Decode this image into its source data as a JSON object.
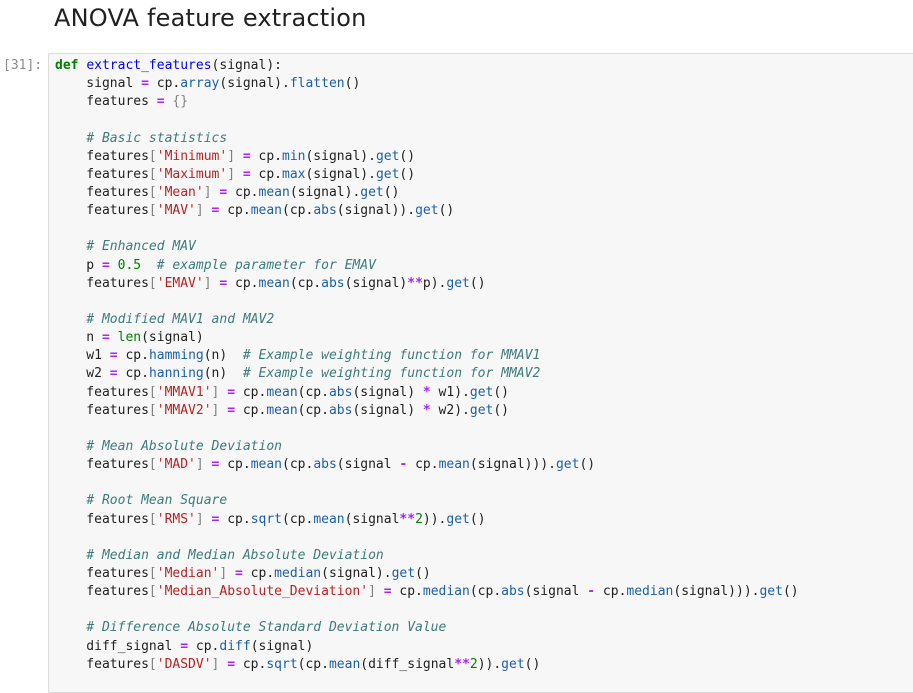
{
  "notebook": {
    "heading": "ANOVA feature extraction",
    "cell": {
      "prompt": "[31]:",
      "language": "python"
    }
  },
  "code_lines": [
    [
      [
        "kw",
        "def"
      ],
      [
        "t",
        " "
      ],
      [
        "fn",
        "extract_features"
      ],
      [
        "t",
        "(signal):"
      ]
    ],
    [
      [
        "t",
        "    signal "
      ],
      [
        "op",
        "="
      ],
      [
        "t",
        " cp."
      ],
      [
        "at",
        "array"
      ],
      [
        "t",
        "(signal)."
      ],
      [
        "at",
        "flatten"
      ],
      [
        "t",
        "()"
      ]
    ],
    [
      [
        "t",
        "    features "
      ],
      [
        "op",
        "="
      ],
      [
        "t",
        " "
      ],
      [
        "br",
        "{}"
      ]
    ],
    [
      [
        "t",
        ""
      ]
    ],
    [
      [
        "t",
        "    "
      ],
      [
        "cm",
        "# Basic statistics"
      ]
    ],
    [
      [
        "t",
        "    features"
      ],
      [
        "br",
        "["
      ],
      [
        "st",
        "'Minimum'"
      ],
      [
        "br",
        "]"
      ],
      [
        "t",
        " "
      ],
      [
        "op",
        "="
      ],
      [
        "t",
        " cp."
      ],
      [
        "at",
        "min"
      ],
      [
        "t",
        "(signal)."
      ],
      [
        "at",
        "get"
      ],
      [
        "t",
        "()"
      ]
    ],
    [
      [
        "t",
        "    features"
      ],
      [
        "br",
        "["
      ],
      [
        "st",
        "'Maximum'"
      ],
      [
        "br",
        "]"
      ],
      [
        "t",
        " "
      ],
      [
        "op",
        "="
      ],
      [
        "t",
        " cp."
      ],
      [
        "at",
        "max"
      ],
      [
        "t",
        "(signal)."
      ],
      [
        "at",
        "get"
      ],
      [
        "t",
        "()"
      ]
    ],
    [
      [
        "t",
        "    features"
      ],
      [
        "br",
        "["
      ],
      [
        "st",
        "'Mean'"
      ],
      [
        "br",
        "]"
      ],
      [
        "t",
        " "
      ],
      [
        "op",
        "="
      ],
      [
        "t",
        " cp."
      ],
      [
        "at",
        "mean"
      ],
      [
        "t",
        "(signal)."
      ],
      [
        "at",
        "get"
      ],
      [
        "t",
        "()"
      ]
    ],
    [
      [
        "t",
        "    features"
      ],
      [
        "br",
        "["
      ],
      [
        "st",
        "'MAV'"
      ],
      [
        "br",
        "]"
      ],
      [
        "t",
        " "
      ],
      [
        "op",
        "="
      ],
      [
        "t",
        " cp."
      ],
      [
        "at",
        "mean"
      ],
      [
        "t",
        "(cp."
      ],
      [
        "at",
        "abs"
      ],
      [
        "t",
        "(signal))."
      ],
      [
        "at",
        "get"
      ],
      [
        "t",
        "()"
      ]
    ],
    [
      [
        "t",
        ""
      ]
    ],
    [
      [
        "t",
        "    "
      ],
      [
        "cm",
        "# Enhanced MAV"
      ]
    ],
    [
      [
        "t",
        "    p "
      ],
      [
        "op",
        "="
      ],
      [
        "t",
        " "
      ],
      [
        "nm",
        "0.5"
      ],
      [
        "t",
        "  "
      ],
      [
        "cm",
        "# example parameter for EMAV"
      ]
    ],
    [
      [
        "t",
        "    features"
      ],
      [
        "br",
        "["
      ],
      [
        "st",
        "'EMAV'"
      ],
      [
        "br",
        "]"
      ],
      [
        "t",
        " "
      ],
      [
        "op",
        "="
      ],
      [
        "t",
        " cp."
      ],
      [
        "at",
        "mean"
      ],
      [
        "t",
        "(cp."
      ],
      [
        "at",
        "abs"
      ],
      [
        "t",
        "(signal)"
      ],
      [
        "op",
        "**"
      ],
      [
        "t",
        "p)."
      ],
      [
        "at",
        "get"
      ],
      [
        "t",
        "()"
      ]
    ],
    [
      [
        "t",
        ""
      ]
    ],
    [
      [
        "t",
        "    "
      ],
      [
        "cm",
        "# Modified MAV1 and MAV2"
      ]
    ],
    [
      [
        "t",
        "    n "
      ],
      [
        "op",
        "="
      ],
      [
        "t",
        " "
      ],
      [
        "bi",
        "len"
      ],
      [
        "t",
        "(signal)"
      ]
    ],
    [
      [
        "t",
        "    w1 "
      ],
      [
        "op",
        "="
      ],
      [
        "t",
        " cp."
      ],
      [
        "at",
        "hamming"
      ],
      [
        "t",
        "(n)  "
      ],
      [
        "cm",
        "# Example weighting function for MMAV1"
      ]
    ],
    [
      [
        "t",
        "    w2 "
      ],
      [
        "op",
        "="
      ],
      [
        "t",
        " cp."
      ],
      [
        "at",
        "hanning"
      ],
      [
        "t",
        "(n)  "
      ],
      [
        "cm",
        "# Example weighting function for MMAV2"
      ]
    ],
    [
      [
        "t",
        "    features"
      ],
      [
        "br",
        "["
      ],
      [
        "st",
        "'MMAV1'"
      ],
      [
        "br",
        "]"
      ],
      [
        "t",
        " "
      ],
      [
        "op",
        "="
      ],
      [
        "t",
        " cp."
      ],
      [
        "at",
        "mean"
      ],
      [
        "t",
        "(cp."
      ],
      [
        "at",
        "abs"
      ],
      [
        "t",
        "(signal) "
      ],
      [
        "op",
        "*"
      ],
      [
        "t",
        " w1)."
      ],
      [
        "at",
        "get"
      ],
      [
        "t",
        "()"
      ]
    ],
    [
      [
        "t",
        "    features"
      ],
      [
        "br",
        "["
      ],
      [
        "st",
        "'MMAV2'"
      ],
      [
        "br",
        "]"
      ],
      [
        "t",
        " "
      ],
      [
        "op",
        "="
      ],
      [
        "t",
        " cp."
      ],
      [
        "at",
        "mean"
      ],
      [
        "t",
        "(cp."
      ],
      [
        "at",
        "abs"
      ],
      [
        "t",
        "(signal) "
      ],
      [
        "op",
        "*"
      ],
      [
        "t",
        " w2)."
      ],
      [
        "at",
        "get"
      ],
      [
        "t",
        "()"
      ]
    ],
    [
      [
        "t",
        ""
      ]
    ],
    [
      [
        "t",
        "    "
      ],
      [
        "cm",
        "# Mean Absolute Deviation"
      ]
    ],
    [
      [
        "t",
        "    features"
      ],
      [
        "br",
        "["
      ],
      [
        "st",
        "'MAD'"
      ],
      [
        "br",
        "]"
      ],
      [
        "t",
        " "
      ],
      [
        "op",
        "="
      ],
      [
        "t",
        " cp."
      ],
      [
        "at",
        "mean"
      ],
      [
        "t",
        "(cp."
      ],
      [
        "at",
        "abs"
      ],
      [
        "t",
        "(signal "
      ],
      [
        "op",
        "-"
      ],
      [
        "t",
        " cp."
      ],
      [
        "at",
        "mean"
      ],
      [
        "t",
        "(signal)))."
      ],
      [
        "at",
        "get"
      ],
      [
        "t",
        "()"
      ]
    ],
    [
      [
        "t",
        ""
      ]
    ],
    [
      [
        "t",
        "    "
      ],
      [
        "cm",
        "# Root Mean Square"
      ]
    ],
    [
      [
        "t",
        "    features"
      ],
      [
        "br",
        "["
      ],
      [
        "st",
        "'RMS'"
      ],
      [
        "br",
        "]"
      ],
      [
        "t",
        " "
      ],
      [
        "op",
        "="
      ],
      [
        "t",
        " cp."
      ],
      [
        "at",
        "sqrt"
      ],
      [
        "t",
        "(cp."
      ],
      [
        "at",
        "mean"
      ],
      [
        "t",
        "(signal"
      ],
      [
        "op",
        "**"
      ],
      [
        "nm",
        "2"
      ],
      [
        "t",
        "))."
      ],
      [
        "at",
        "get"
      ],
      [
        "t",
        "()"
      ]
    ],
    [
      [
        "t",
        ""
      ]
    ],
    [
      [
        "t",
        "    "
      ],
      [
        "cm",
        "# Median and Median Absolute Deviation"
      ]
    ],
    [
      [
        "t",
        "    features"
      ],
      [
        "br",
        "["
      ],
      [
        "st",
        "'Median'"
      ],
      [
        "br",
        "]"
      ],
      [
        "t",
        " "
      ],
      [
        "op",
        "="
      ],
      [
        "t",
        " cp."
      ],
      [
        "at",
        "median"
      ],
      [
        "t",
        "(signal)."
      ],
      [
        "at",
        "get"
      ],
      [
        "t",
        "()"
      ]
    ],
    [
      [
        "t",
        "    features"
      ],
      [
        "br",
        "["
      ],
      [
        "st",
        "'Median_Absolute_Deviation'"
      ],
      [
        "br",
        "]"
      ],
      [
        "t",
        " "
      ],
      [
        "op",
        "="
      ],
      [
        "t",
        " cp."
      ],
      [
        "at",
        "median"
      ],
      [
        "t",
        "(cp."
      ],
      [
        "at",
        "abs"
      ],
      [
        "t",
        "(signal "
      ],
      [
        "op",
        "-"
      ],
      [
        "t",
        " cp."
      ],
      [
        "at",
        "median"
      ],
      [
        "t",
        "(signal)))."
      ],
      [
        "at",
        "get"
      ],
      [
        "t",
        "()"
      ]
    ],
    [
      [
        "t",
        ""
      ]
    ],
    [
      [
        "t",
        "    "
      ],
      [
        "cm",
        "# Difference Absolute Standard Deviation Value"
      ]
    ],
    [
      [
        "t",
        "    diff_signal "
      ],
      [
        "op",
        "="
      ],
      [
        "t",
        " cp."
      ],
      [
        "at",
        "diff"
      ],
      [
        "t",
        "(signal)"
      ]
    ],
    [
      [
        "t",
        "    features"
      ],
      [
        "br",
        "["
      ],
      [
        "st",
        "'DASDV'"
      ],
      [
        "br",
        "]"
      ],
      [
        "t",
        " "
      ],
      [
        "op",
        "="
      ],
      [
        "t",
        " cp."
      ],
      [
        "at",
        "sqrt"
      ],
      [
        "t",
        "(cp."
      ],
      [
        "at",
        "mean"
      ],
      [
        "t",
        "(diff_signal"
      ],
      [
        "op",
        "**"
      ],
      [
        "nm",
        "2"
      ],
      [
        "t",
        "))."
      ],
      [
        "at",
        "get"
      ],
      [
        "t",
        "()"
      ]
    ]
  ]
}
